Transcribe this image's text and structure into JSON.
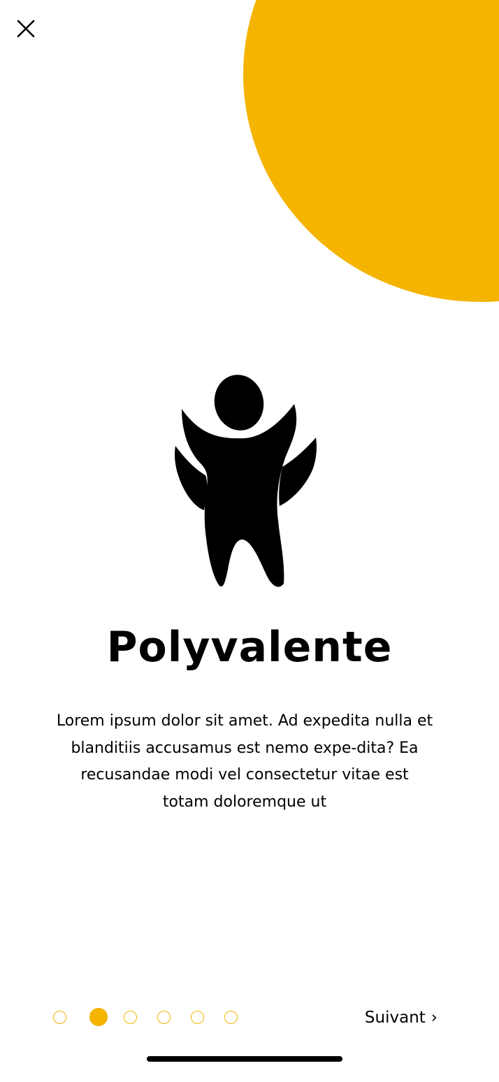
{
  "onboarding": {
    "close_icon": "close-icon",
    "hero_icon": "person-cheering-icon",
    "title": "Polyvalente",
    "description": "Lorem ipsum dolor sit amet. Ad expedita nulla et blanditiis accusamus est nemo expe-dita? Ea recusandae modi vel consectetur vitae est totam doloremque ut",
    "pagination": {
      "total": 6,
      "active_index": 1
    },
    "next_label": "Suivant",
    "next_chevron": "›"
  },
  "colors": {
    "accent": "#F4B400",
    "text": "#000000",
    "background": "#FFFFFF"
  }
}
